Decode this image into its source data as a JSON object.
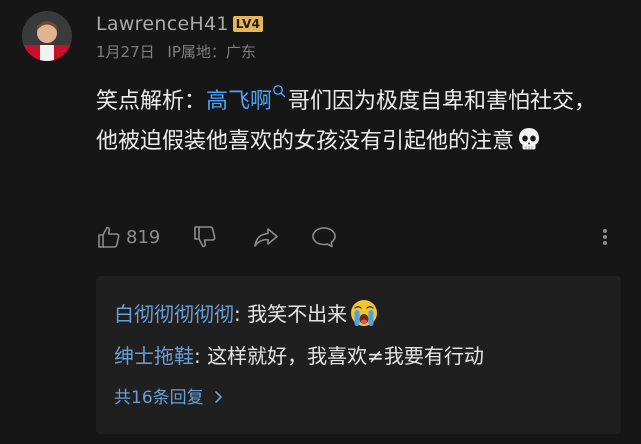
{
  "comment": {
    "username": "LawrenceH41",
    "level_badge": "LV4",
    "date": "1月27日",
    "ip_location": "IP属地：广东",
    "text_before_mention": "笑点解析：",
    "mention": "高飞啊",
    "text_after_mention": "哥们因为极度自卑和害怕社交，他被迫假装他喜欢的女孩没有引起他的注意",
    "emoji": "skull",
    "like_count": "819"
  },
  "icons": {
    "mention": "search-icon",
    "like": "thumbs-up-icon",
    "dislike": "thumbs-down-icon",
    "share": "share-icon",
    "reply": "comment-icon",
    "more": "more-vertical-icon"
  },
  "replies": [
    {
      "author": "白彻彻彻彻彻",
      "separator": ": ",
      "text": "我笑不出来",
      "emoji": "crying"
    },
    {
      "author": "绅士拖鞋",
      "separator": ": ",
      "text": "这样就好，我喜欢≠我要有行动"
    }
  ],
  "more_replies_label": "共16条回复",
  "colors": {
    "background": "#161616",
    "reply_background": "#1f1f1f",
    "link_blue": "#4ea1f5",
    "reply_author_blue": "#6a9fd6",
    "badge_gold": "#e6b55a"
  }
}
